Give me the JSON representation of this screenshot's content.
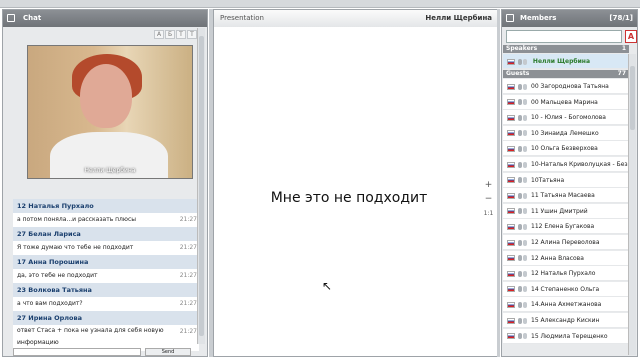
{
  "chat": {
    "title": "Chat",
    "tools": [
      "A",
      "Б",
      "T",
      "T"
    ],
    "video_label": "Нелли Щербина",
    "messages": [
      {
        "name": "12 Наталья Пурхало",
        "text": "а потом поняла...и рассказать плюсы",
        "time": "21:27"
      },
      {
        "name": "27 Белан Лариса",
        "text": "Я тоже думаю что тебе не подходит",
        "time": "21:27"
      },
      {
        "name": "17 Анна Порошина",
        "text": "да, это тебе не подходит",
        "time": "21:27"
      },
      {
        "name": "23 Волкова Татьяна",
        "text": "а что вам подходит?",
        "time": "21:27"
      },
      {
        "name": "27 Ирина Орлова",
        "text": "ответ Стаса + пока не узнала для себя новую информацию",
        "time": "21:27"
      }
    ],
    "send_label": "Send"
  },
  "presentation": {
    "title": "Presentation",
    "owner": "Нелли Щербина",
    "slide_text": "Мне это не подходит",
    "zoom_in": "+",
    "zoom_out": "−",
    "fit": "1:1"
  },
  "members": {
    "title": "Members",
    "count": "[78/1]",
    "filter_icon": "A",
    "speakers_label": "Speakers",
    "guests_label": "Guests",
    "guests_count": "77",
    "speakers": [
      "Нелли Щербина"
    ],
    "guests": [
      "00 Загороднова Татьяна",
      "00 Мальцева Марина",
      "10 - Юлия - Богомолова",
      "10 Зинаида Лемешко",
      "10 Ольга Безверхова",
      "10-Наталья Криволуцкая - Без",
      "10Татьяна",
      "11 Татьяна Масаева",
      "11 Ушин Дмитрий",
      "112 Елена Бугакова",
      "12 Алина Переволова",
      "12 Анна Власова",
      "12 Наталья Пурхало",
      "14 Степаненко Ольга",
      "14.Анна Ахметжанова",
      "15 Александр Кискин",
      "15 Людмила Терещенко"
    ]
  }
}
